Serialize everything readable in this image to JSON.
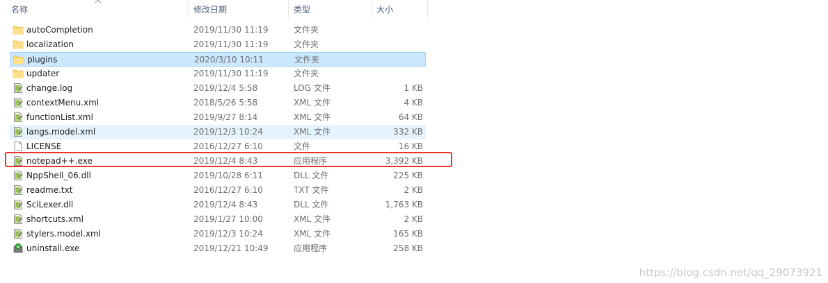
{
  "columns": {
    "name": "名称",
    "date": "修改日期",
    "type": "类型",
    "size": "大小"
  },
  "files": [
    {
      "name": "autoCompletion",
      "date": "2019/11/30 11:19",
      "type": "文件夹",
      "size": "",
      "icon": "folder-icon"
    },
    {
      "name": "localization",
      "date": "2019/11/30 11:19",
      "type": "文件夹",
      "size": "",
      "icon": "folder-icon"
    },
    {
      "name": "plugins",
      "date": "2020/3/10 10:11",
      "type": "文件夹",
      "size": "",
      "icon": "folder-icon",
      "state": "selected"
    },
    {
      "name": "updater",
      "date": "2019/11/30 11:19",
      "type": "文件夹",
      "size": "",
      "icon": "folder-icon"
    },
    {
      "name": "change.log",
      "date": "2019/12/4 5:58",
      "type": "LOG 文件",
      "size": "1 KB",
      "icon": "notepad-document-icon"
    },
    {
      "name": "contextMenu.xml",
      "date": "2018/5/26 5:58",
      "type": "XML 文件",
      "size": "4 KB",
      "icon": "notepad-document-icon"
    },
    {
      "name": "functionList.xml",
      "date": "2019/9/27 8:14",
      "type": "XML 文件",
      "size": "64 KB",
      "icon": "notepad-document-icon"
    },
    {
      "name": "langs.model.xml",
      "date": "2019/12/3 10:24",
      "type": "XML 文件",
      "size": "332 KB",
      "icon": "notepad-document-icon",
      "state": "hover"
    },
    {
      "name": "LICENSE",
      "date": "2016/12/27 6:10",
      "type": "文件",
      "size": "16 KB",
      "icon": "blank-document-icon"
    },
    {
      "name": "notepad++.exe",
      "date": "2019/12/4 8:43",
      "type": "应用程序",
      "size": "3,392 KB",
      "icon": "notepad-document-icon"
    },
    {
      "name": "NppShell_06.dll",
      "date": "2019/10/28 6:11",
      "type": "DLL 文件",
      "size": "225 KB",
      "icon": "notepad-document-icon"
    },
    {
      "name": "readme.txt",
      "date": "2016/12/27 6:10",
      "type": "TXT 文件",
      "size": "2 KB",
      "icon": "notepad-document-icon"
    },
    {
      "name": "SciLexer.dll",
      "date": "2019/12/4 8:43",
      "type": "DLL 文件",
      "size": "1,763 KB",
      "icon": "notepad-document-icon"
    },
    {
      "name": "shortcuts.xml",
      "date": "2019/1/27 10:00",
      "type": "XML 文件",
      "size": "2 KB",
      "icon": "notepad-document-icon"
    },
    {
      "name": "stylers.model.xml",
      "date": "2019/12/3 10:24",
      "type": "XML 文件",
      "size": "165 KB",
      "icon": "notepad-document-icon"
    },
    {
      "name": "uninstall.exe",
      "date": "2019/12/21 10:49",
      "type": "应用程序",
      "size": "258 KB",
      "icon": "installer-icon"
    }
  ],
  "annotation": {
    "highlighted_file": "notepad++.exe",
    "color": "#e8332c"
  },
  "watermark": "https://blog.csdn.net/qq_29073921",
  "colors": {
    "selected_bg": "#cce8ff",
    "hover_bg": "#e5f3ff",
    "header_text": "#4c607a"
  }
}
